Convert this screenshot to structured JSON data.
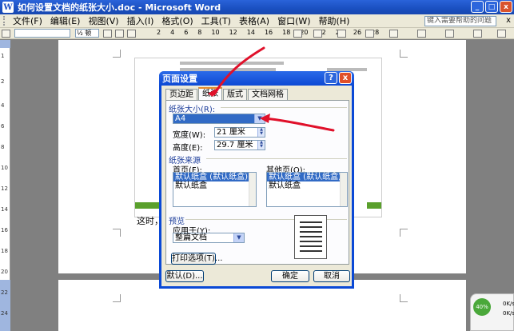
{
  "window": {
    "title": "如何设置文档的纸张大小.doc - Microsoft Word",
    "app_icon_letter": "W",
    "minimize_label": "_",
    "maximize_label": "□",
    "close_label": "x"
  },
  "menubar": {
    "items": [
      "文件(F)",
      "编辑(E)",
      "视图(V)",
      "插入(I)",
      "格式(O)",
      "工具(T)",
      "表格(A)",
      "窗口(W)",
      "帮助(H)"
    ],
    "help_placeholder": "键入需要帮助的问题",
    "close_label": "x"
  },
  "toolbar": {
    "zoom_label": "½ 顿",
    "ruler_numbers": [
      "2",
      "4",
      "6",
      "8",
      "10",
      "12",
      "14",
      "16",
      "18",
      "20",
      "22",
      "24",
      "26",
      "28"
    ]
  },
  "vruler": {
    "numbers": [
      "1",
      "2",
      "4",
      "6",
      "8",
      "10",
      "12",
      "14",
      "16",
      "18",
      "20",
      "22",
      "24"
    ]
  },
  "document": {
    "text_line": "这时，我"
  },
  "dialog": {
    "title": "页面设置",
    "help_label": "?",
    "close_label": "x",
    "tabs": [
      "页边距",
      "纸张",
      "版式",
      "文档网格"
    ],
    "active_tab": 1,
    "paper_size_group": "纸张大小(R):",
    "paper_size_value": "A4",
    "width_label": "宽度(W):",
    "width_value": "21 厘米",
    "height_label": "高度(E):",
    "height_value": "29.7 厘米",
    "paper_source_group": "纸张来源",
    "first_page_label": "首页(F):",
    "other_pages_label": "其他页(O):",
    "first_page_options": [
      "默认纸盒 (默认纸盒)",
      "默认纸盒"
    ],
    "other_pages_options": [
      "默认纸盒 (默认纸盒)",
      "默认纸盒"
    ],
    "preview_group": "预览",
    "apply_to_label": "应用于(Y):",
    "apply_to_value": "整篇文档",
    "print_options_button": "打印选项(T)...",
    "default_button": "默认(D)...",
    "ok_button": "确定",
    "cancel_button": "取消"
  },
  "tray": {
    "percent": "40%",
    "up_speed": "0K/s",
    "down_speed": "0K/s"
  },
  "colors": {
    "titlebar": "#1a4fc0",
    "chrome": "#ece9d8",
    "annotation_red": "#e0102a",
    "selection": "#316ac5"
  }
}
